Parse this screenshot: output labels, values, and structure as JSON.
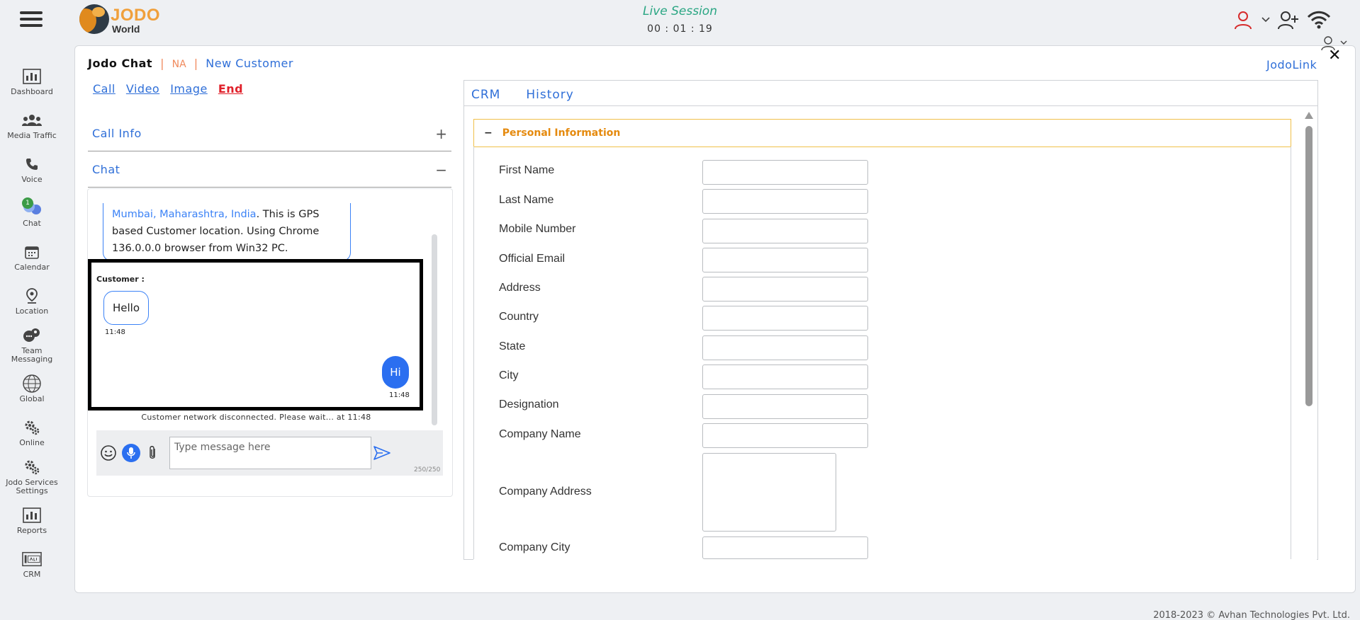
{
  "app": {
    "logo_word1": "JODO",
    "logo_word2": "World",
    "session_title": "Live Session",
    "session_time": "00 : 01 : 19"
  },
  "sidebar": {
    "items": [
      {
        "label": "Dashboard",
        "icon": "dashboard-icon"
      },
      {
        "label": "Media Traffic",
        "icon": "users-group-icon"
      },
      {
        "label": "Voice",
        "icon": "phone-icon"
      },
      {
        "label": "Chat",
        "icon": "chat-icon",
        "badge": "1"
      },
      {
        "label": "Calendar",
        "icon": "calendar-icon"
      },
      {
        "label": "Location",
        "icon": "location-pin-icon"
      },
      {
        "label": "Team Messaging",
        "icon": "team-chat-icon"
      },
      {
        "label": "Global",
        "icon": "globe-icon"
      },
      {
        "label": "Online",
        "icon": "gears-icon"
      },
      {
        "label": "Jodo Services Settings",
        "icon": "gears-icon"
      },
      {
        "label": "Reports",
        "icon": "reports-icon"
      },
      {
        "label": "CRM",
        "icon": "crm-icon"
      }
    ]
  },
  "chat": {
    "title": "Jodo Chat",
    "separator": "|",
    "status": "NA",
    "customer_type": "New Customer",
    "jodolink": "JodoLink",
    "actions": {
      "call": "Call",
      "video": "Video",
      "image": "Image",
      "end": "End"
    },
    "sections": {
      "call_info": "Call Info",
      "call_info_sign": "+",
      "chat": "Chat",
      "chat_sign": "−"
    },
    "location_text": {
      "place": "Mumbai, Maharashtra, India",
      "rest": ". This is GPS based Customer location. Using Chrome 136.0.0.0 browser from Win32 PC."
    },
    "messages": {
      "sender_label": "Customer :",
      "incoming": {
        "text": "Hello",
        "time": "11:48"
      },
      "outgoing": {
        "text": "Hi",
        "time": "11:48"
      }
    },
    "disconnect_note": "Customer network disconnected. Please wait... at 11:48",
    "composer": {
      "placeholder": "Type message here",
      "counter": "250/250"
    }
  },
  "crm": {
    "tabs": [
      "CRM",
      "History"
    ],
    "section_title": "Personal Information",
    "section_toggle": "−",
    "fields": [
      "First Name",
      "Last Name",
      "Mobile Number",
      "Official Email",
      "Address",
      "Country",
      "State",
      "City",
      "Designation",
      "Company Name",
      "Company Address",
      "Company City"
    ]
  },
  "footer": "2018-2023 © Avhan Technologies Pvt. Ltd.",
  "colors": {
    "accent": "#2f6fd8",
    "end": "#e0202a",
    "orange": "#e58a0e",
    "session": "#2aa683"
  }
}
